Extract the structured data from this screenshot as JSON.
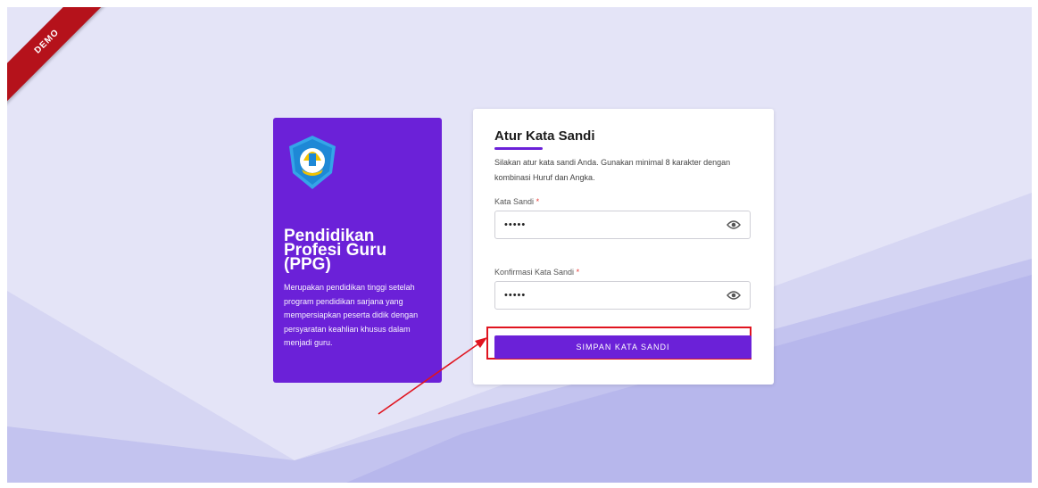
{
  "ribbon": {
    "label": "DEMO"
  },
  "info_card": {
    "title": "Pendidikan Profesi Guru (PPG)",
    "description": "Merupakan pendidikan tinggi setelah program pendidikan sarjana yang mempersiapkan peserta didik dengan persyaratan keahlian khusus dalam menjadi guru."
  },
  "form": {
    "title": "Atur Kata Sandi",
    "description": "Silakan atur kata sandi Anda. Gunakan minimal 8 karakter dengan kombinasi Huruf dan Angka.",
    "password_label": "Kata Sandi",
    "password_value": "•••••",
    "confirm_label": "Konfirmasi Kata Sandi",
    "confirm_value": "•••••",
    "required_mark": "*",
    "save_label": "SIMPAN KATA SANDI"
  },
  "colors": {
    "accent": "#6b21d8",
    "highlight": "#e0141f",
    "ribbon": "#b5121b"
  },
  "icons": [
    "eye-icon",
    "logo-tut-wuri-handayani"
  ]
}
